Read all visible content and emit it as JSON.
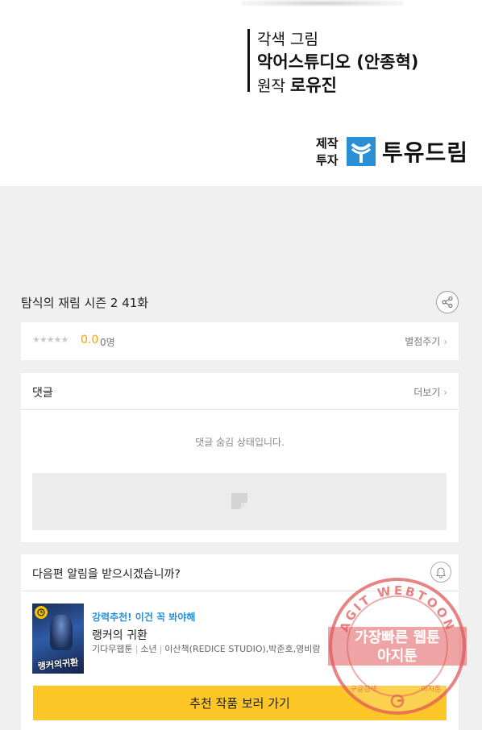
{
  "credits": {
    "line1": "각색 그림",
    "line2": "악어스튜디오 (안종혁)",
    "line3_role": "원작",
    "line3_name": "로유진",
    "role1": "제작",
    "role2": "투자",
    "company": "투유드림",
    "logo_color": "#2b8fd6"
  },
  "episode": {
    "title": "탐식의 재림 시즌 2 41화",
    "share_icon": "share-icon"
  },
  "rating": {
    "stars": "★★★★★",
    "score": "0.0",
    "count": "0명",
    "rate_link": "별점주기"
  },
  "comments": {
    "title": "댓글",
    "more": "더보기",
    "hidden_message": "댓글 숨김 상태입니다."
  },
  "notify": {
    "question": "다음편 알림을 받으시겠습니까?",
    "bell_icon": "bell-icon"
  },
  "recommend": {
    "tag": "강력추천! 이건 꼭 봐야해",
    "title": "랭커의 귀환",
    "meta": [
      "기다무웹툰",
      "소년",
      "이산책(REDICE STUDIO),박준호,영비람"
    ],
    "thumb_title": "랭커의귀환",
    "cta": "추천 작품 보러 가기",
    "cta_color": "#fcc727",
    "tag_color": "#2a8fd8"
  },
  "watermark": {
    "arc_text": "AGIT WEBTOON",
    "line1": "가장빠른 웹툰",
    "line2": "아지툰",
    "bottom_left": "구글검색",
    "bottom_right": "아지툰",
    "color": "#e05a5a"
  }
}
